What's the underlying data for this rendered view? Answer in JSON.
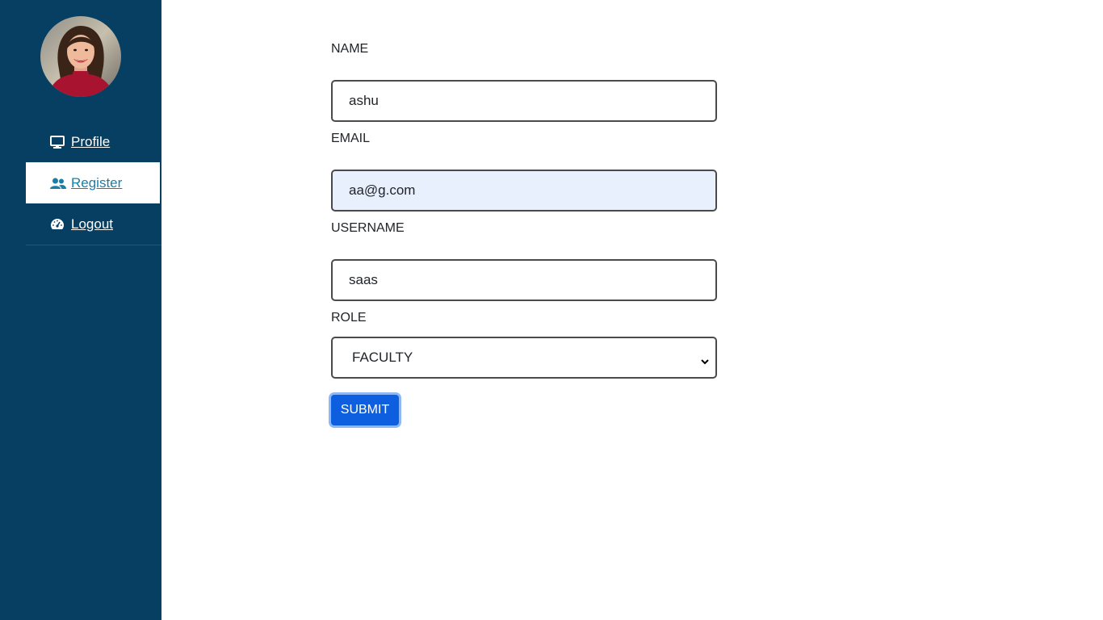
{
  "sidebar": {
    "avatar": {
      "icon": "user-avatar-photo"
    },
    "items": [
      {
        "label": " Profile",
        "icon": "monitor-icon",
        "active": false
      },
      {
        "label": " Register",
        "icon": "users-icon",
        "active": true
      },
      {
        "label": " Logout",
        "icon": "dashboard-gauge-icon",
        "active": false
      }
    ]
  },
  "form": {
    "name": {
      "label": "NAME",
      "value": "ashu"
    },
    "email": {
      "label": "EMAIL",
      "value": "aa@g.com"
    },
    "username": {
      "label": "USERNAME",
      "value": "saas"
    },
    "role": {
      "label": "ROLE",
      "value": "FACULTY"
    },
    "submit_label": "SUBMIT"
  },
  "colors": {
    "sidebar_bg": "#073f63",
    "active_text": "#1a7fa8",
    "submit_bg": "#0d5fe0",
    "autofill_bg": "#e8f0fe"
  }
}
